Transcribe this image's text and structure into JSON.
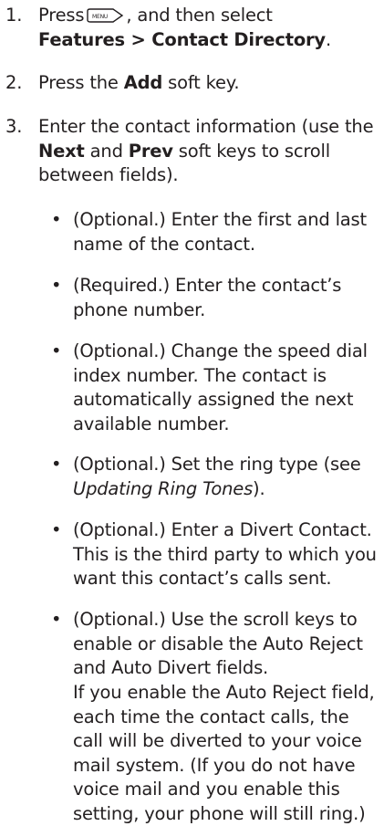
{
  "steps": [
    {
      "num": "1.",
      "pre": "Press",
      "icon": "menu-key-icon",
      "mid": ", and then select",
      "bold": "Features > Contact Directory",
      "post": "."
    },
    {
      "num": "2.",
      "pre": "Press the",
      "bold": "Add",
      "post": "soft key."
    },
    {
      "num": "3.",
      "pre": "Enter the contact information (use the",
      "bold1": "Next",
      "and": "and",
      "bold2": "Prev",
      "post": "soft keys to scroll between fields)."
    }
  ],
  "bullets": [
    {
      "text": "(Optional.) Enter the first and last name of the contact."
    },
    {
      "text": "(Required.) Enter the contact’s phone number."
    },
    {
      "text": "(Optional.) Change the speed dial index number. The contact is automatically assigned the next available number."
    },
    {
      "pre": "(Optional.) Set the ring type (see",
      "italic": "Updating Ring Tones",
      "post": ")."
    },
    {
      "text": "(Optional.) Enter a Divert Contact. This is the third party to which you want this contact’s calls sent."
    },
    {
      "text": "(Optional.) Use the scroll keys to enable or disable the Auto Reject and Auto Divert fields."
    }
  ],
  "note": "If you enable the Auto Reject field, each time the contact calls, the call will be diverted to your voice mail system. (If you do not have voice mail and you enable this setting, your phone will still ring.)",
  "bullet_glyph": "•"
}
